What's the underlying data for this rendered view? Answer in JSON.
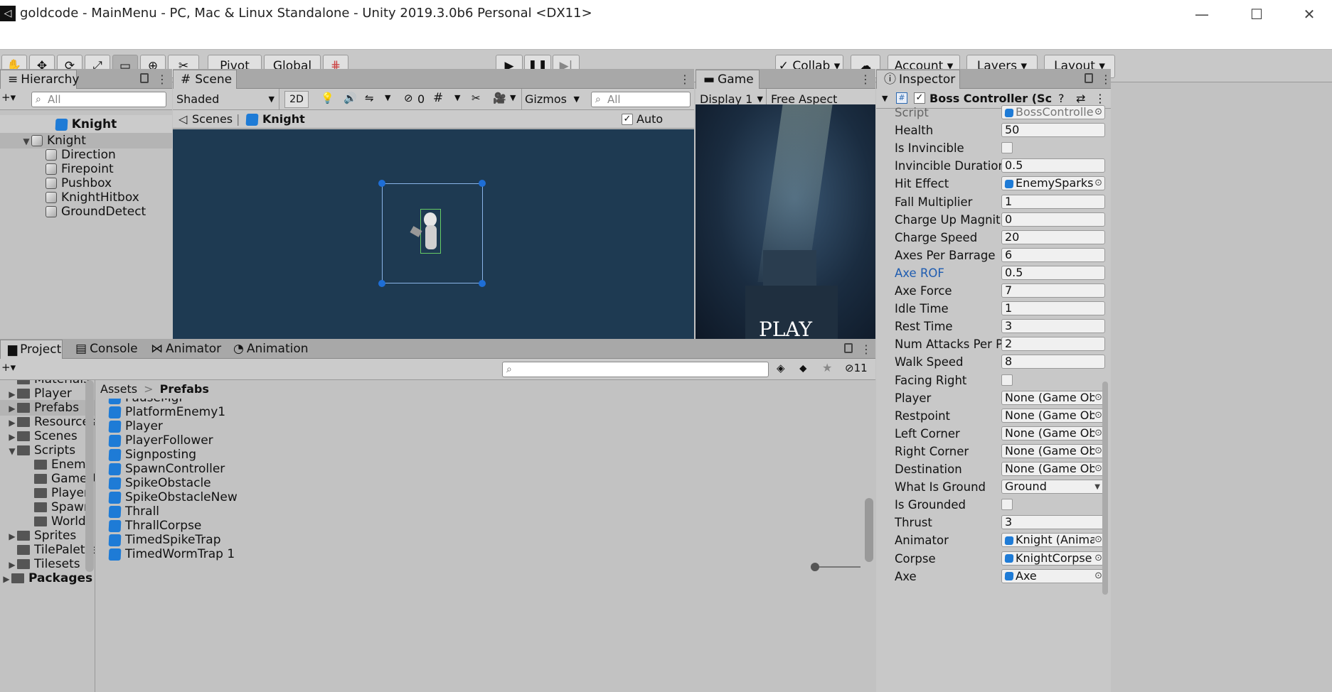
{
  "window": {
    "title": "goldcode - MainMenu - PC, Mac & Linux Standalone - Unity 2019.3.0b6 Personal <DX11>",
    "unity_glyph": "◁",
    "minimize": "—",
    "maximize": "☐",
    "close": "✕"
  },
  "toolbar": {
    "tools": [
      "✋",
      "✥",
      "⟳",
      "⤢",
      "▭",
      "⊕",
      "✂"
    ],
    "pivot": "Pivot",
    "global": "Global",
    "play": "▶",
    "pause": "❚❚",
    "step": "▶|",
    "collab": "✓ Collab ▾",
    "cloud": "☁",
    "account": "Account ▾",
    "layers": "Layers ▾",
    "layout": "Layout ▾"
  },
  "hierarchy": {
    "tab": "Hierarchy",
    "search_placeholder": "All",
    "add": "+▾",
    "scene_name": "Knight",
    "root": "Knight",
    "children": [
      "Direction",
      "Firepoint",
      "Pushbox",
      "KnightHitbox",
      "GroundDetect"
    ]
  },
  "scene": {
    "tab": "Scene",
    "shading": "Shaded",
    "mode2d": "2D",
    "hidden_count": "0",
    "gizmos": "Gizmos",
    "search_placeholder": "All",
    "breadcrumb_scenes": "Scenes",
    "breadcrumb_object": "Knight",
    "auto_save_label": "Auto Save",
    "auto_save_check": "✓",
    "icons": [
      "💡",
      "🔊",
      "⇋",
      "⊘",
      "#",
      "✂",
      "🎥"
    ]
  },
  "game": {
    "tab": "Game",
    "display": "Display 1",
    "aspect": "Free Aspect",
    "play_text": "PLAY"
  },
  "project": {
    "tabs": [
      "Project",
      "Console",
      "Animator",
      "Animation"
    ],
    "add": "+▾",
    "hidden_count": "11",
    "breadcrumb_root": "Assets",
    "breadcrumb_sep": ">",
    "breadcrumb_current": "Prefabs",
    "folders": [
      {
        "label": "Materials",
        "arrow": "",
        "indent": 1
      },
      {
        "label": "Player",
        "arrow": "▶",
        "indent": 1
      },
      {
        "label": "Prefabs",
        "arrow": "▶",
        "indent": 1
      },
      {
        "label": "Resources",
        "arrow": "▶",
        "indent": 1
      },
      {
        "label": "Scenes",
        "arrow": "▶",
        "indent": 1
      },
      {
        "label": "Scripts",
        "arrow": "▼",
        "indent": 1
      },
      {
        "label": "Enemy",
        "arrow": "",
        "indent": 2
      },
      {
        "label": "GameUI",
        "arrow": "",
        "indent": 2
      },
      {
        "label": "Player",
        "arrow": "",
        "indent": 2
      },
      {
        "label": "Spawn",
        "arrow": "",
        "indent": 2
      },
      {
        "label": "World",
        "arrow": "",
        "indent": 2
      },
      {
        "label": "Sprites",
        "arrow": "▶",
        "indent": 1
      },
      {
        "label": "TilePalette",
        "arrow": "",
        "indent": 1
      },
      {
        "label": "Tilesets",
        "arrow": "▶",
        "indent": 1
      },
      {
        "label": "Packages",
        "arrow": "▶",
        "indent": 0
      }
    ],
    "assets": [
      "PauseMgr",
      "PlatformEnemy1",
      "Player",
      "PlayerFollower",
      "Signposting",
      "SpawnController",
      "SpikeObstacle",
      "SpikeObstacleNew",
      "Thrall",
      "ThrallCorpse",
      "TimedSpikeTrap",
      "TimedWormTrap 1"
    ]
  },
  "inspector": {
    "tab": "Inspector",
    "component": "Boss Controller (Script)",
    "properties": [
      {
        "label": "Script",
        "value": "BossController",
        "kind": "ref"
      },
      {
        "label": "Health",
        "value": "50",
        "kind": "text"
      },
      {
        "label": "Is Invincible",
        "value": "",
        "kind": "check"
      },
      {
        "label": "Invincible Duration",
        "value": "0.5",
        "kind": "text"
      },
      {
        "label": "Hit Effect",
        "value": "EnemySparks",
        "kind": "ref"
      },
      {
        "label": "Fall Multiplier",
        "value": "1",
        "kind": "text"
      },
      {
        "label": "Charge Up Magnitude",
        "value": "0",
        "kind": "text"
      },
      {
        "label": "Charge Speed",
        "value": "20",
        "kind": "text"
      },
      {
        "label": "Axes Per Barrage",
        "value": "6",
        "kind": "text"
      },
      {
        "label": "Axe ROF",
        "value": "0.5",
        "kind": "text",
        "blue": true
      },
      {
        "label": "Axe Force",
        "value": "7",
        "kind": "text"
      },
      {
        "label": "Idle Time",
        "value": "1",
        "kind": "text"
      },
      {
        "label": "Rest Time",
        "value": "3",
        "kind": "text"
      },
      {
        "label": "Num Attacks Per Phase",
        "value": "2",
        "kind": "text"
      },
      {
        "label": "Walk Speed",
        "value": "8",
        "kind": "text"
      },
      {
        "label": "Facing Right",
        "value": "",
        "kind": "check"
      },
      {
        "label": "Player",
        "value": "None (Game Object)",
        "kind": "ref"
      },
      {
        "label": "Restpoint",
        "value": "None (Game Object)",
        "kind": "ref"
      },
      {
        "label": "Left Corner",
        "value": "None (Game Object)",
        "kind": "ref"
      },
      {
        "label": "Right Corner",
        "value": "None (Game Object)",
        "kind": "ref"
      },
      {
        "label": "Destination",
        "value": "None (Game Object)",
        "kind": "ref"
      },
      {
        "label": "What Is Ground",
        "value": "Ground",
        "kind": "dropdown"
      },
      {
        "label": "Is Grounded",
        "value": "",
        "kind": "check"
      },
      {
        "label": "Thrust",
        "value": "3",
        "kind": "text"
      },
      {
        "label": "Animator",
        "value": "Knight (Animator)",
        "kind": "ref"
      },
      {
        "label": "Corpse",
        "value": "KnightCorpse",
        "kind": "ref"
      },
      {
        "label": "Axe",
        "value": "Axe",
        "kind": "ref"
      }
    ]
  },
  "colors": {
    "scene_bg": "#1e3a52",
    "accent": "#1e6ed6"
  }
}
